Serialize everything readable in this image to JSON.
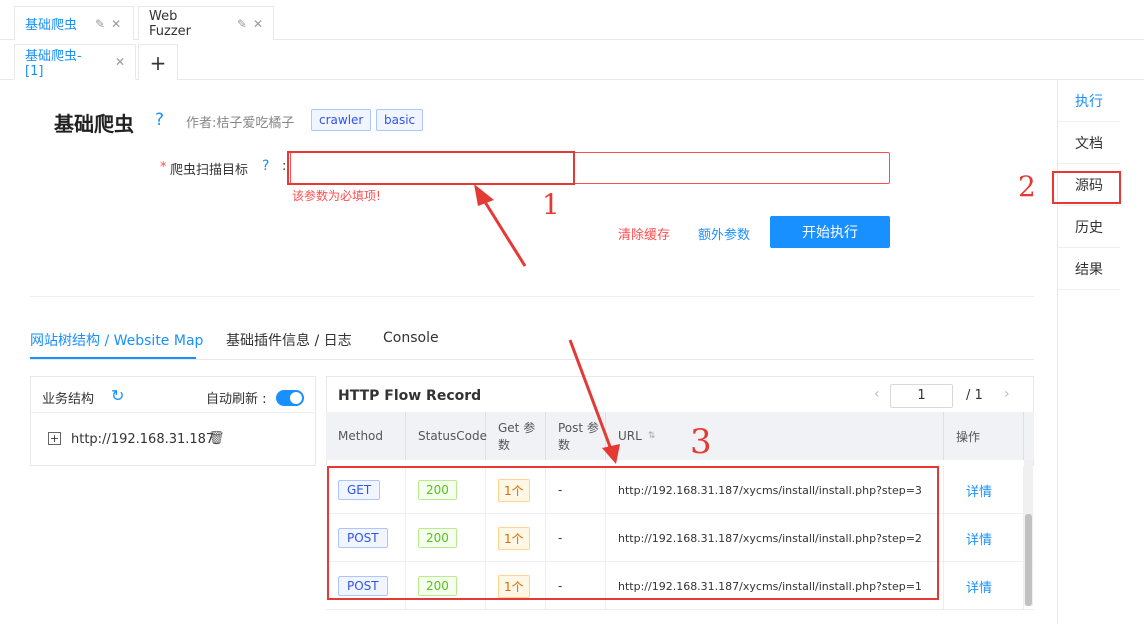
{
  "top_tabs": [
    {
      "label": "基础爬虫",
      "active": true
    },
    {
      "label": "Web Fuzzer",
      "active": false
    }
  ],
  "sub_tabs": [
    {
      "label": "基础爬虫-[1]"
    }
  ],
  "add_tab_symbol": "+",
  "side_nav": [
    "执行",
    "文档",
    "源码",
    "历史",
    "结果"
  ],
  "plugin": {
    "title": "基础爬虫",
    "author": "作者:桔子爱吃橘子",
    "tags": [
      "crawler",
      "basic"
    ]
  },
  "form": {
    "target_label": "爬虫扫描目标",
    "required_mark": "*",
    "colon": ":",
    "target_value": "",
    "error_text": "该参数为必填项!",
    "clear_cache": "清除缓存",
    "extra_params": "额外参数",
    "start": "开始执行"
  },
  "result_tabs": [
    "网站树结构 / Website Map",
    "基础插件信息 / 日志",
    "Console"
  ],
  "tree": {
    "title": "业务结构",
    "auto_refresh_label": "自动刷新 :",
    "auto_refresh_on": true,
    "node": "http://192.168.31.187"
  },
  "flow": {
    "title": "HTTP Flow Record",
    "page": "1",
    "total_pages": "/ 1",
    "columns": [
      "Method",
      "StatusCode",
      "Get 参数",
      "Post 参数",
      "URL",
      "操作"
    ],
    "rows": [
      {
        "method": "GET",
        "status": "200",
        "get": "1个",
        "post": "-",
        "url": "http://192.168.31.187/xycms/install/install.php?step=3",
        "action": "详情"
      },
      {
        "method": "POST",
        "status": "200",
        "get": "1个",
        "post": "-",
        "url": "http://192.168.31.187/xycms/install/install.php?step=2",
        "action": "详情"
      },
      {
        "method": "POST",
        "status": "200",
        "get": "1个",
        "post": "-",
        "url": "http://192.168.31.187/xycms/install/install.php?step=1",
        "action": "详情"
      }
    ]
  },
  "annotations": {
    "n1": "1",
    "n2": "2",
    "n3": "3"
  },
  "colors": {
    "accent": "#1890ff",
    "annotation": "#e53935",
    "error": "#ff4d4f"
  }
}
